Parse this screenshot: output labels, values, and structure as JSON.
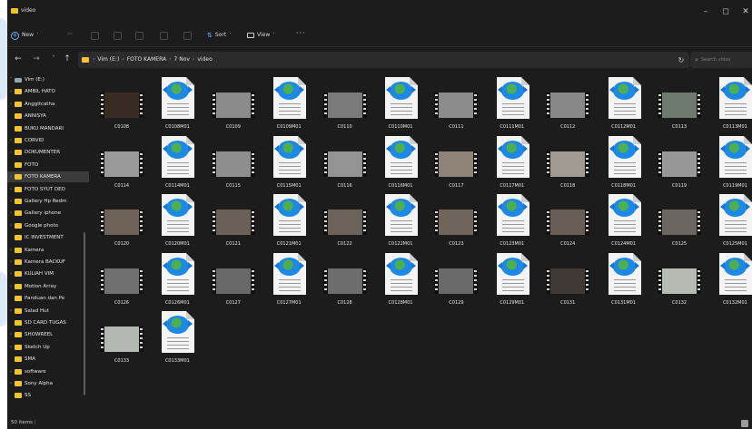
{
  "window": {
    "title": "video",
    "controls": {
      "minimize": "–",
      "maximize": "◻",
      "close": "✕"
    }
  },
  "commandbar": {
    "new_label": "New",
    "new_caret": "˅",
    "sort_label": "Sort",
    "sort_caret": "˅",
    "view_label": "View",
    "view_caret": "˅",
    "more_label": "···",
    "icons": [
      "cut-icon",
      "copy-icon",
      "paste-icon",
      "rename-icon",
      "share-icon",
      "delete-icon"
    ]
  },
  "navigation": {
    "back": "←",
    "forward": "→",
    "history": "˅",
    "up": "↑",
    "refresh": "↻",
    "dropdown": "˅"
  },
  "address": {
    "breadcrumbs": [
      "Vim (E:)",
      "FOTO KAMERA",
      "7 Nov",
      "video"
    ],
    "separator": "›"
  },
  "search": {
    "placeholder": "Search video",
    "glyph": "⌕"
  },
  "sidebar": {
    "items": [
      {
        "label": "Vim (E:)",
        "chevron": "˅",
        "icon": "drive"
      },
      {
        "label": "AMBIL HATO",
        "chevron": "›",
        "icon": "folder"
      },
      {
        "label": "Anggitcatha",
        "chevron": "›",
        "icon": "folder"
      },
      {
        "label": "ANNISYA",
        "chevron": "",
        "icon": "folder"
      },
      {
        "label": "BUKU MANDARI",
        "chevron": "",
        "icon": "folder"
      },
      {
        "label": "CORVID",
        "chevron": "›",
        "icon": "folder"
      },
      {
        "label": "DOKUMENTER",
        "chevron": "›",
        "icon": "folder"
      },
      {
        "label": "FOTO",
        "chevron": "",
        "icon": "folder"
      },
      {
        "label": "FOTO KAMERA",
        "chevron": "›",
        "icon": "folder",
        "selected": true
      },
      {
        "label": "FOTO SYUT DED",
        "chevron": "›",
        "icon": "folder"
      },
      {
        "label": "Gallery Hp Redm",
        "chevron": "›",
        "icon": "folder"
      },
      {
        "label": "Gallery iphone",
        "chevron": "›",
        "icon": "folder"
      },
      {
        "label": "Google photo",
        "chevron": "›",
        "icon": "folder"
      },
      {
        "label": "IC INVESTMENT",
        "chevron": "",
        "icon": "folder"
      },
      {
        "label": "Kamera",
        "chevron": "›",
        "icon": "folder"
      },
      {
        "label": "Kamera BACKUF",
        "chevron": "›",
        "icon": "folder"
      },
      {
        "label": "KULIAH VIM",
        "chevron": "›",
        "icon": "folder"
      },
      {
        "label": "Motion Array",
        "chevron": "›",
        "icon": "folder"
      },
      {
        "label": "Panduan dan Pe",
        "chevron": "",
        "icon": "folder"
      },
      {
        "label": "Salad Hut",
        "chevron": "›",
        "icon": "folder"
      },
      {
        "label": "SD CARD TUGAS",
        "chevron": "",
        "icon": "folder"
      },
      {
        "label": "SHOWREEL",
        "chevron": "›",
        "icon": "folder"
      },
      {
        "label": "Sketch Up",
        "chevron": "›",
        "icon": "folder"
      },
      {
        "label": "SMA",
        "chevron": "",
        "icon": "folder"
      },
      {
        "label": "software",
        "chevron": "›",
        "icon": "folder"
      },
      {
        "label": "Sony Alpha",
        "chevron": "›",
        "icon": "folder"
      },
      {
        "label": "SS",
        "chevron": "",
        "icon": "folder"
      }
    ]
  },
  "files": [
    {
      "name": "C0108",
      "kind": "video",
      "tone": "#3a2a24"
    },
    {
      "name": "C0108M01",
      "kind": "xml"
    },
    {
      "name": "C0109",
      "kind": "video",
      "tone": "#8b8b8b"
    },
    {
      "name": "C0109M01",
      "kind": "xml"
    },
    {
      "name": "C0110",
      "kind": "video",
      "tone": "#7a7a7a"
    },
    {
      "name": "C0110M01",
      "kind": "xml"
    },
    {
      "name": "C0111",
      "kind": "video",
      "tone": "#8c8c8c"
    },
    {
      "name": "C0111M01",
      "kind": "xml"
    },
    {
      "name": "C0112",
      "kind": "video",
      "tone": "#888888"
    },
    {
      "name": "C0112M01",
      "kind": "xml"
    },
    {
      "name": "C0113",
      "kind": "video",
      "tone": "#6f7a6f"
    },
    {
      "name": "C0113M01",
      "kind": "xml"
    },
    {
      "name": "C0114",
      "kind": "video",
      "tone": "#9a9a9a"
    },
    {
      "name": "C0114M01",
      "kind": "xml"
    },
    {
      "name": "C0115",
      "kind": "video",
      "tone": "#8e8e8e"
    },
    {
      "name": "C0115M01",
      "kind": "xml"
    },
    {
      "name": "C0116",
      "kind": "video",
      "tone": "#949494"
    },
    {
      "name": "C0116M01",
      "kind": "xml"
    },
    {
      "name": "C0117",
      "kind": "video",
      "tone": "#8f8378"
    },
    {
      "name": "C0117M01",
      "kind": "xml"
    },
    {
      "name": "C0118",
      "kind": "video",
      "tone": "#a09a92"
    },
    {
      "name": "C0118M01",
      "kind": "xml"
    },
    {
      "name": "C0119",
      "kind": "video",
      "tone": "#989898"
    },
    {
      "name": "C0119M01",
      "kind": "xml"
    },
    {
      "name": "C0120",
      "kind": "video",
      "tone": "#6e6258"
    },
    {
      "name": "C0120M01",
      "kind": "xml"
    },
    {
      "name": "C0121",
      "kind": "video",
      "tone": "#6a6058"
    },
    {
      "name": "C0121M01",
      "kind": "xml"
    },
    {
      "name": "C0122",
      "kind": "video",
      "tone": "#6c625a"
    },
    {
      "name": "C0122M01",
      "kind": "xml"
    },
    {
      "name": "C0123",
      "kind": "video",
      "tone": "#6f655c"
    },
    {
      "name": "C0123M01",
      "kind": "xml"
    },
    {
      "name": "C0124",
      "kind": "video",
      "tone": "#6a5f56"
    },
    {
      "name": "C0124M01",
      "kind": "xml"
    },
    {
      "name": "C0125",
      "kind": "video",
      "tone": "#6b6660"
    },
    {
      "name": "C0125M01",
      "kind": "xml"
    },
    {
      "name": "C0126",
      "kind": "video",
      "tone": "#707070"
    },
    {
      "name": "C0126M01",
      "kind": "xml"
    },
    {
      "name": "C0127",
      "kind": "video",
      "tone": "#686868"
    },
    {
      "name": "C0127M01",
      "kind": "xml"
    },
    {
      "name": "C0128",
      "kind": "video",
      "tone": "#6d6d6d"
    },
    {
      "name": "C0128M01",
      "kind": "xml"
    },
    {
      "name": "C0129",
      "kind": "video",
      "tone": "#6a6a6a"
    },
    {
      "name": "C0129M01",
      "kind": "xml"
    },
    {
      "name": "C0131",
      "kind": "video",
      "tone": "#3f3a36"
    },
    {
      "name": "C0131M01",
      "kind": "xml"
    },
    {
      "name": "C0132",
      "kind": "video",
      "tone": "#b6bcb3"
    },
    {
      "name": "C0132M01",
      "kind": "xml"
    },
    {
      "name": "C0133",
      "kind": "video",
      "tone": "#b4b8b2"
    },
    {
      "name": "C0133M01",
      "kind": "xml"
    }
  ],
  "status": {
    "count": "50 items",
    "separator": "|"
  },
  "colors": {
    "window_bg": "#1c1c1c",
    "folder": "#f4c430",
    "accent": "#6fb1ff",
    "selected": "#3b3b3b"
  }
}
